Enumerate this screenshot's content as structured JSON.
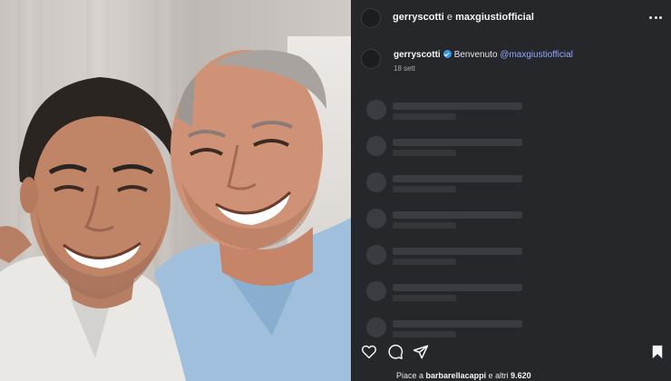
{
  "header": {
    "user1": "gerryscotti",
    "conjunction": "e",
    "user2": "maxgiustiofficial",
    "more_icon": "more-horizontal-icon"
  },
  "caption": {
    "username": "gerryscotti",
    "verified_icon": "verified-badge-icon",
    "text": "Benvenuto",
    "mention": "@maxgiustiofficial",
    "date": "18 sett"
  },
  "comments": {
    "loading_placeholders": 7
  },
  "actions": {
    "like_icon": "heart-icon",
    "comment_icon": "comment-bubble-icon",
    "share_icon": "send-paper-plane-icon",
    "save_icon": "bookmark-icon"
  },
  "likes": {
    "prefix": "Piace a",
    "user": "barbarellacappi",
    "middle": "e altri",
    "count": "9.620"
  },
  "colors": {
    "panel_background": "#25272b",
    "mention": "#8fa8ff",
    "verified": "#3797f0",
    "skeleton": "#3a3c41"
  }
}
